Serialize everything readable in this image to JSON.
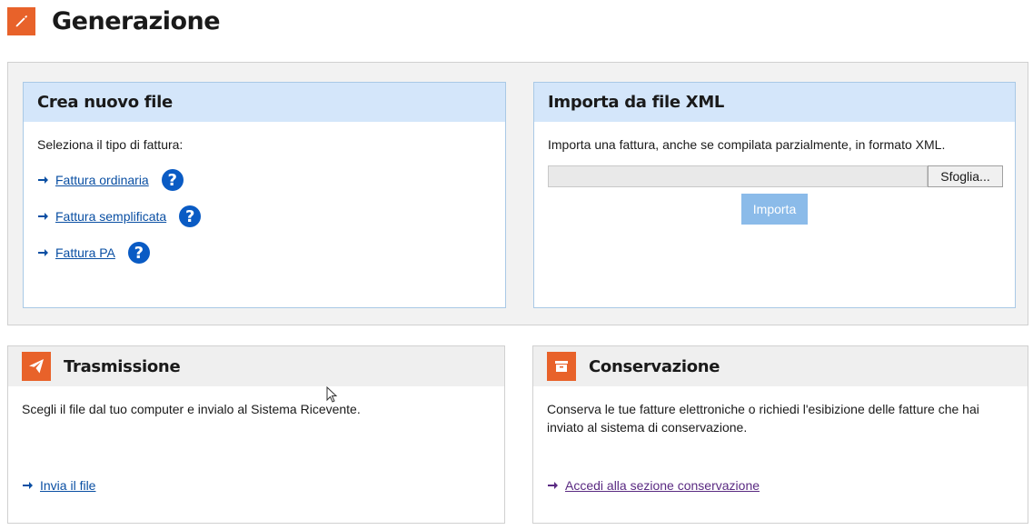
{
  "header": {
    "title": "Generazione",
    "icon": "pencil-icon"
  },
  "crea": {
    "title": "Crea nuovo file",
    "intro": "Seleziona il tipo di fattura:",
    "links": [
      {
        "label": "Fattura ordinaria",
        "help": "?"
      },
      {
        "label": "Fattura semplificata",
        "help": "?"
      },
      {
        "label": "Fattura PA",
        "help": "?"
      }
    ]
  },
  "importa": {
    "title": "Importa da file XML",
    "intro": "Importa una fattura, anche se compilata parzialmente, in formato XML.",
    "browse_label": "Sfoglia...",
    "import_label": "Importa"
  },
  "trasmissione": {
    "title": "Trasmissione",
    "icon": "paper-plane-icon",
    "description": "Scegli il file dal tuo computer e invialo al Sistema Ricevente.",
    "link": "Invia il file"
  },
  "conservazione": {
    "title": "Conservazione",
    "icon": "archive-box-icon",
    "description": "Conserva le tue fatture elettroniche o richiedi l'esibizione delle fatture che hai inviato al sistema di conservazione.",
    "link": "Accedi alla sezione conservazione"
  },
  "colors": {
    "accent": "#e8622a",
    "link": "#0a4fa3",
    "help": "#0a5bc4",
    "card_head_blue": "#d4e6fa"
  }
}
